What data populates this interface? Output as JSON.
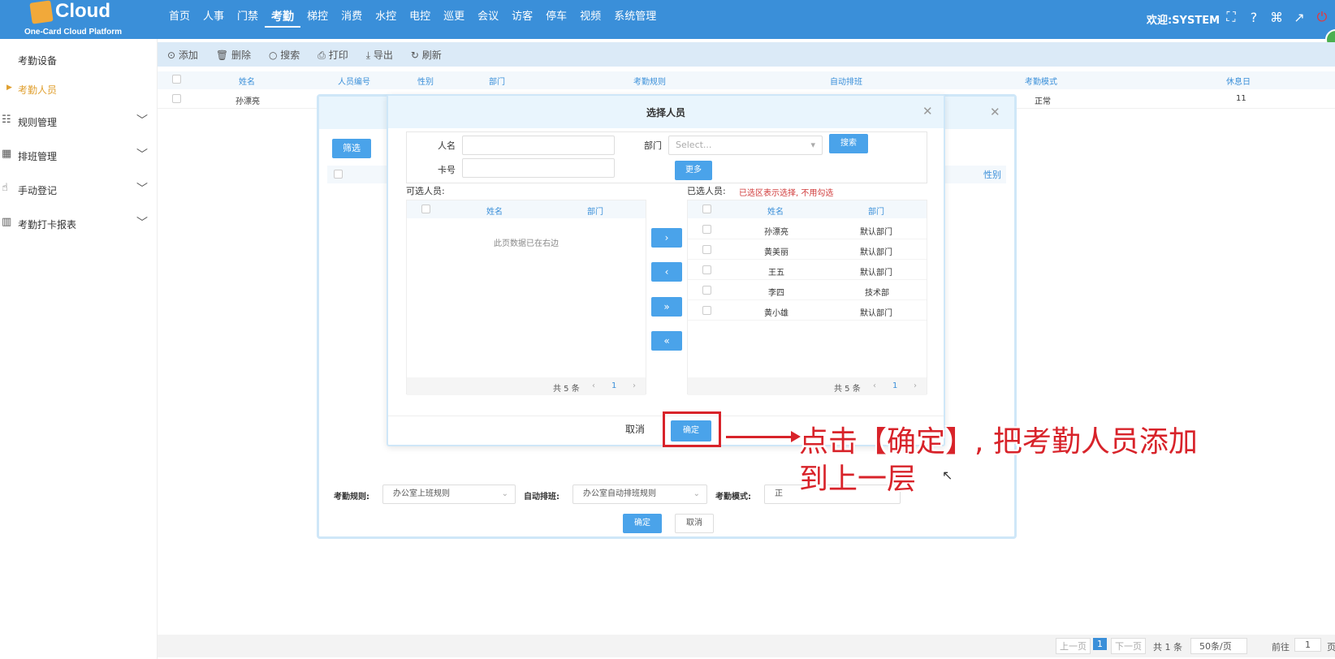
{
  "header": {
    "logo_text": "Cloud",
    "logo_sub": "One-Card Cloud Platform",
    "nav": [
      "首页",
      "人事",
      "门禁",
      "考勤",
      "梯控",
      "消费",
      "水控",
      "电控",
      "巡更",
      "会议",
      "访客",
      "停车",
      "视频",
      "系统管理"
    ],
    "active_nav": "考勤",
    "welcome": "欢迎:SYSTEM"
  },
  "sidebar": {
    "items": [
      {
        "label": "考勤设备"
      },
      {
        "label": "考勤人员"
      },
      {
        "label": "规则管理"
      },
      {
        "label": "排班管理"
      },
      {
        "label": "手动登记"
      },
      {
        "label": "考勤打卡报表"
      }
    ]
  },
  "toolbar": {
    "add": "添加",
    "delete": "删除",
    "search": "搜索",
    "print": "打印",
    "export": "导出",
    "refresh": "刷新"
  },
  "grid": {
    "headers": [
      "姓名",
      "人员编号",
      "性别",
      "部门",
      "考勤规则",
      "自动排班",
      "考勤模式",
      "休息日"
    ],
    "row": {
      "name": "孙漂亮",
      "mode": "正常",
      "rest": "11"
    }
  },
  "outer_dialog": {
    "filter_btn": "筛选",
    "gender_col": "性别",
    "rule_label": "考勤规则:",
    "rule_value": "办公室上班规则",
    "auto_label": "自动排班:",
    "auto_value": "办公室自动排班规则",
    "mode_label": "考勤模式:",
    "mode_value": "正",
    "ok": "确定",
    "cancel": "取消"
  },
  "inner_dialog": {
    "title": "选择人员",
    "name_label": "人名",
    "card_label": "卡号",
    "dept_label": "部门",
    "dept_placeholder": "Select...",
    "search_btn": "搜索",
    "more_btn": "更多",
    "available_label": "可选人员:",
    "selected_label": "已选人员:",
    "selected_note": "已选区表示选择, 不用勾选",
    "col_name": "姓名",
    "col_dept": "部门",
    "empty_text": "此页数据已在右边",
    "selected_rows": [
      {
        "name": "孙漂亮",
        "dept": "默认部门"
      },
      {
        "name": "黄美丽",
        "dept": "默认部门"
      },
      {
        "name": "王五",
        "dept": "默认部门"
      },
      {
        "name": "李四",
        "dept": "技术部"
      },
      {
        "name": "黄小雄",
        "dept": "默认部门"
      }
    ],
    "total_left": "共 5 条",
    "total_right": "共 5 条",
    "page": "1",
    "move_right": "›",
    "move_left": "‹",
    "move_all_right": "»",
    "move_all_left": "«",
    "cancel": "取消",
    "ok": "确定"
  },
  "annotation": {
    "line1": "点击【确定】, 把考勤人员添加",
    "line2": "到上一层"
  },
  "pager": {
    "prev": "上一页",
    "current": "1",
    "next": "下一页",
    "total": "共 1 条",
    "per_page": "50条/页",
    "goto": "前往",
    "goto_value": "1",
    "page_unit": "页"
  },
  "colors": {
    "primary": "#3a8fd9",
    "button": "#4aa3ea",
    "annotation_red": "#d8232a"
  }
}
